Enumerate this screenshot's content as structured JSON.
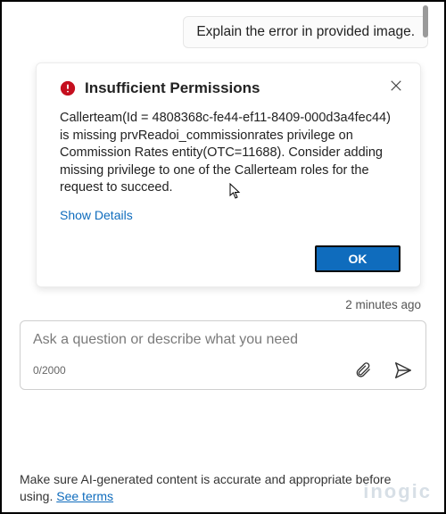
{
  "user_message": "Explain the error in provided image.",
  "dialog": {
    "title": "Insufficient Permissions",
    "body": "Callerteam(Id = 4808368c-fe44-ef11-8409-000d3a4fec44) is missing prvReadoi_commissionrates privilege on Commission Rates entity(OTC=11688). Consider adding missing privilege to one of the Callerteam roles for the request to succeed.",
    "show_details": "Show Details",
    "ok": "OK"
  },
  "timestamp": "2 minutes ago",
  "input": {
    "placeholder": "Ask a question or describe what you need",
    "char_count": "0/2000"
  },
  "disclaimer": {
    "text_a": "Make sure AI-generated content is accurate and appropriate before using. ",
    "link": "See terms"
  },
  "watermark": "inogic"
}
